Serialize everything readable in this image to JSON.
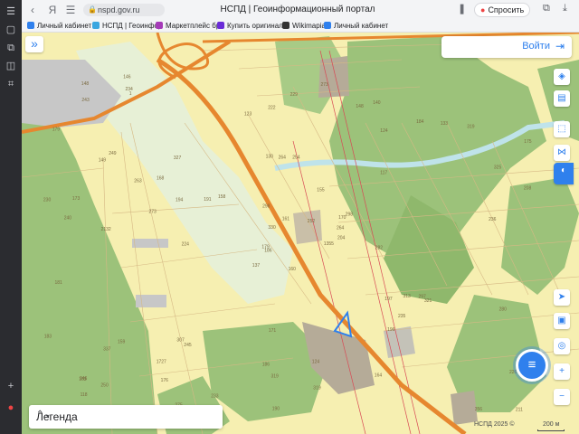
{
  "browser": {
    "url": "nspd.gov.ru",
    "title": "НСПД | Геоинформационный портал",
    "ask_button": "Спросить",
    "bookmarks": [
      {
        "label": "Личный кабинет",
        "color": "#2f80ed"
      },
      {
        "label": "НСПД | Геоинфор",
        "color": "#3aa6e0"
      },
      {
        "label": "Маркетплейс бр",
        "color": "#a53ab8"
      },
      {
        "label": "Купить оригинал",
        "color": "#6a2bd8"
      },
      {
        "label": "Wikimapia",
        "color": "#333333"
      },
      {
        "label": "Личный кабинет",
        "color": "#2f80ed"
      }
    ]
  },
  "map": {
    "login_label": "Войти",
    "legend_label": "Легенда",
    "attribution": "НСПД 2025 ©",
    "scale_label": "200 м",
    "parcel_numbers": [
      "160",
      "149",
      "186",
      "246",
      "170",
      "245",
      "140",
      "254",
      "124",
      "1355",
      "1",
      "211",
      "2132",
      "175",
      "137",
      "117",
      "112",
      "130",
      "155",
      "159",
      "158",
      "118",
      "176",
      "264",
      "298",
      "321",
      "249",
      "222",
      "240",
      "197",
      "208",
      "179",
      "186",
      "330",
      "327",
      "184",
      "307",
      "356",
      "226",
      "297",
      "273",
      "191",
      "273",
      "196",
      "275",
      "230",
      "264",
      "311",
      "319",
      "204",
      "337",
      "325",
      "179",
      "235",
      "164",
      "1727",
      "234",
      "148",
      "124",
      "319",
      "229",
      "224",
      "173",
      "168",
      "133",
      "146",
      "148",
      "123",
      "161",
      "183",
      "171",
      "233",
      "313",
      "194",
      "163",
      "243",
      "263",
      "181",
      "298",
      "319",
      "252",
      "250",
      "282",
      "280",
      "190",
      "236"
    ]
  },
  "colors": {
    "accent": "#2f80ed",
    "map_land": "#f6efb1",
    "forest": "#9cc27a",
    "road": "#e6872f"
  }
}
